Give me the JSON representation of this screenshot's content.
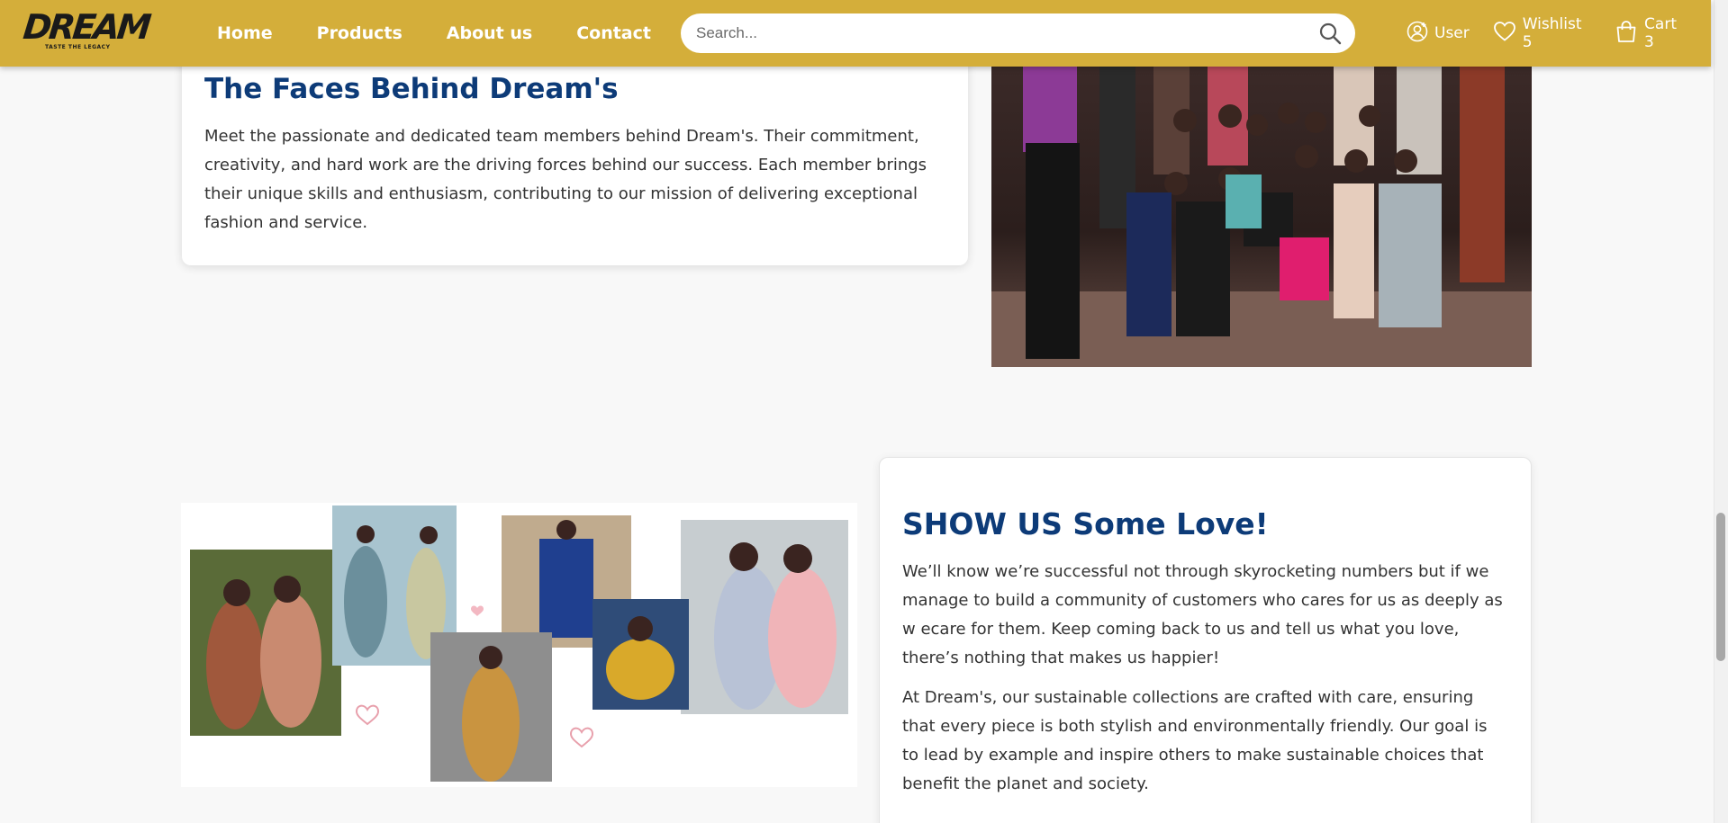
{
  "brand": {
    "logo_text": "DREAM",
    "tagline": "TASTE THE LEGACY",
    "color": "#d4ae3a",
    "heading_color": "#0d3b78"
  },
  "nav": {
    "links": [
      "Home",
      "Products",
      "About us",
      "Contact"
    ]
  },
  "search": {
    "placeholder": "Search...",
    "value": ""
  },
  "actions": {
    "user_label": "User",
    "wishlist_label": "Wishlist 5",
    "cart_label": "Cart 3"
  },
  "team_section": {
    "title": "The Faces Behind Dream's",
    "text": "Meet the passionate and dedicated team members behind Dream's. Their commitment, creativity, and hard work are the driving forces behind our success. Each member brings their unique skills and enthusiasm, contributing to our mission of delivering exceptional fashion and service."
  },
  "love_section": {
    "title": "SHOW US Some Love!",
    "paragraph_1": "We’ll know we’re successful not through skyrocketing numbers but if we manage to build a community of customers who cares for us as deeply as w ecare for them. Keep coming back to us and tell us what you love, there’s nothing that makes us happier!",
    "paragraph_2": "At Dream's, our sustainable collections are crafted with care, ensuring that every piece is both stylish and environmentally friendly. Our goal is to lead by example and inspire others to make sustainable choices that benefit the planet and society."
  }
}
